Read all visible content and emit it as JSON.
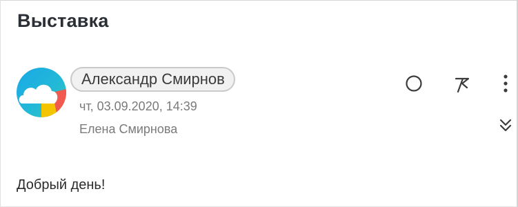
{
  "message": {
    "subject": "Выставка",
    "sender": {
      "name": "Александр Смирнов",
      "avatar_icon": "cloud-logo-icon"
    },
    "date": "чт, 03.09.2020, 14:39",
    "recipient": "Елена Смирнова",
    "body": "Добрый день!"
  },
  "actions": {
    "mark_read_icon": "circle-icon",
    "flag_icon": "flag-icon",
    "more_icon": "more-vertical-icon",
    "expand_icon": "chevron-double-down-icon"
  },
  "colors": {
    "subject_text": "#2b2f36",
    "secondary_text": "#7a7a7a",
    "chip_background": "#f1f1f1",
    "chip_border": "#c9c9c9",
    "icon_color": "#3c3c3c",
    "avatar_blue": "#1aa9e6",
    "avatar_teal": "#34c7b8",
    "avatar_yellow": "#f5c400",
    "avatar_red": "#f15a4f"
  }
}
